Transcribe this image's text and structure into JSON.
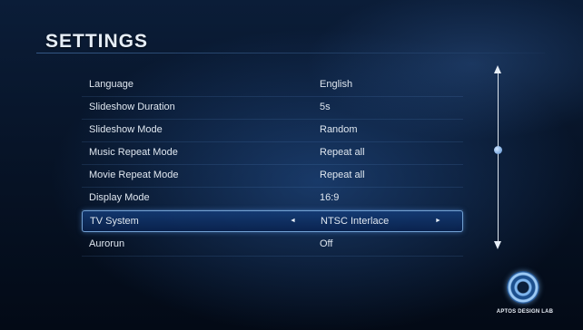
{
  "screen": {
    "title": "SETTINGS"
  },
  "settings": {
    "items": [
      {
        "label": "Language",
        "value": "English"
      },
      {
        "label": "Slideshow Duration",
        "value": "5s"
      },
      {
        "label": "Slideshow Mode",
        "value": "Random"
      },
      {
        "label": "Music Repeat Mode",
        "value": "Repeat all"
      },
      {
        "label": "Movie Repeat Mode",
        "value": "Repeat all"
      },
      {
        "label": "Display Mode",
        "value": "16:9"
      },
      {
        "label": "TV System",
        "value": "NTSC Interlace",
        "selected": true
      },
      {
        "label": "Aurorun",
        "value": "Off"
      }
    ],
    "selected_arrows": {
      "left": "◄",
      "right": "►"
    }
  },
  "scrollbar": {
    "position_fraction": 0.45
  },
  "brand": {
    "logo_text": "APTOS DESIGN LAB",
    "icon": "circular-logo-icon"
  },
  "colors": {
    "accent": "#5a8fd0",
    "highlight_border": "#8cbef0",
    "text": "#dfe7f0"
  }
}
